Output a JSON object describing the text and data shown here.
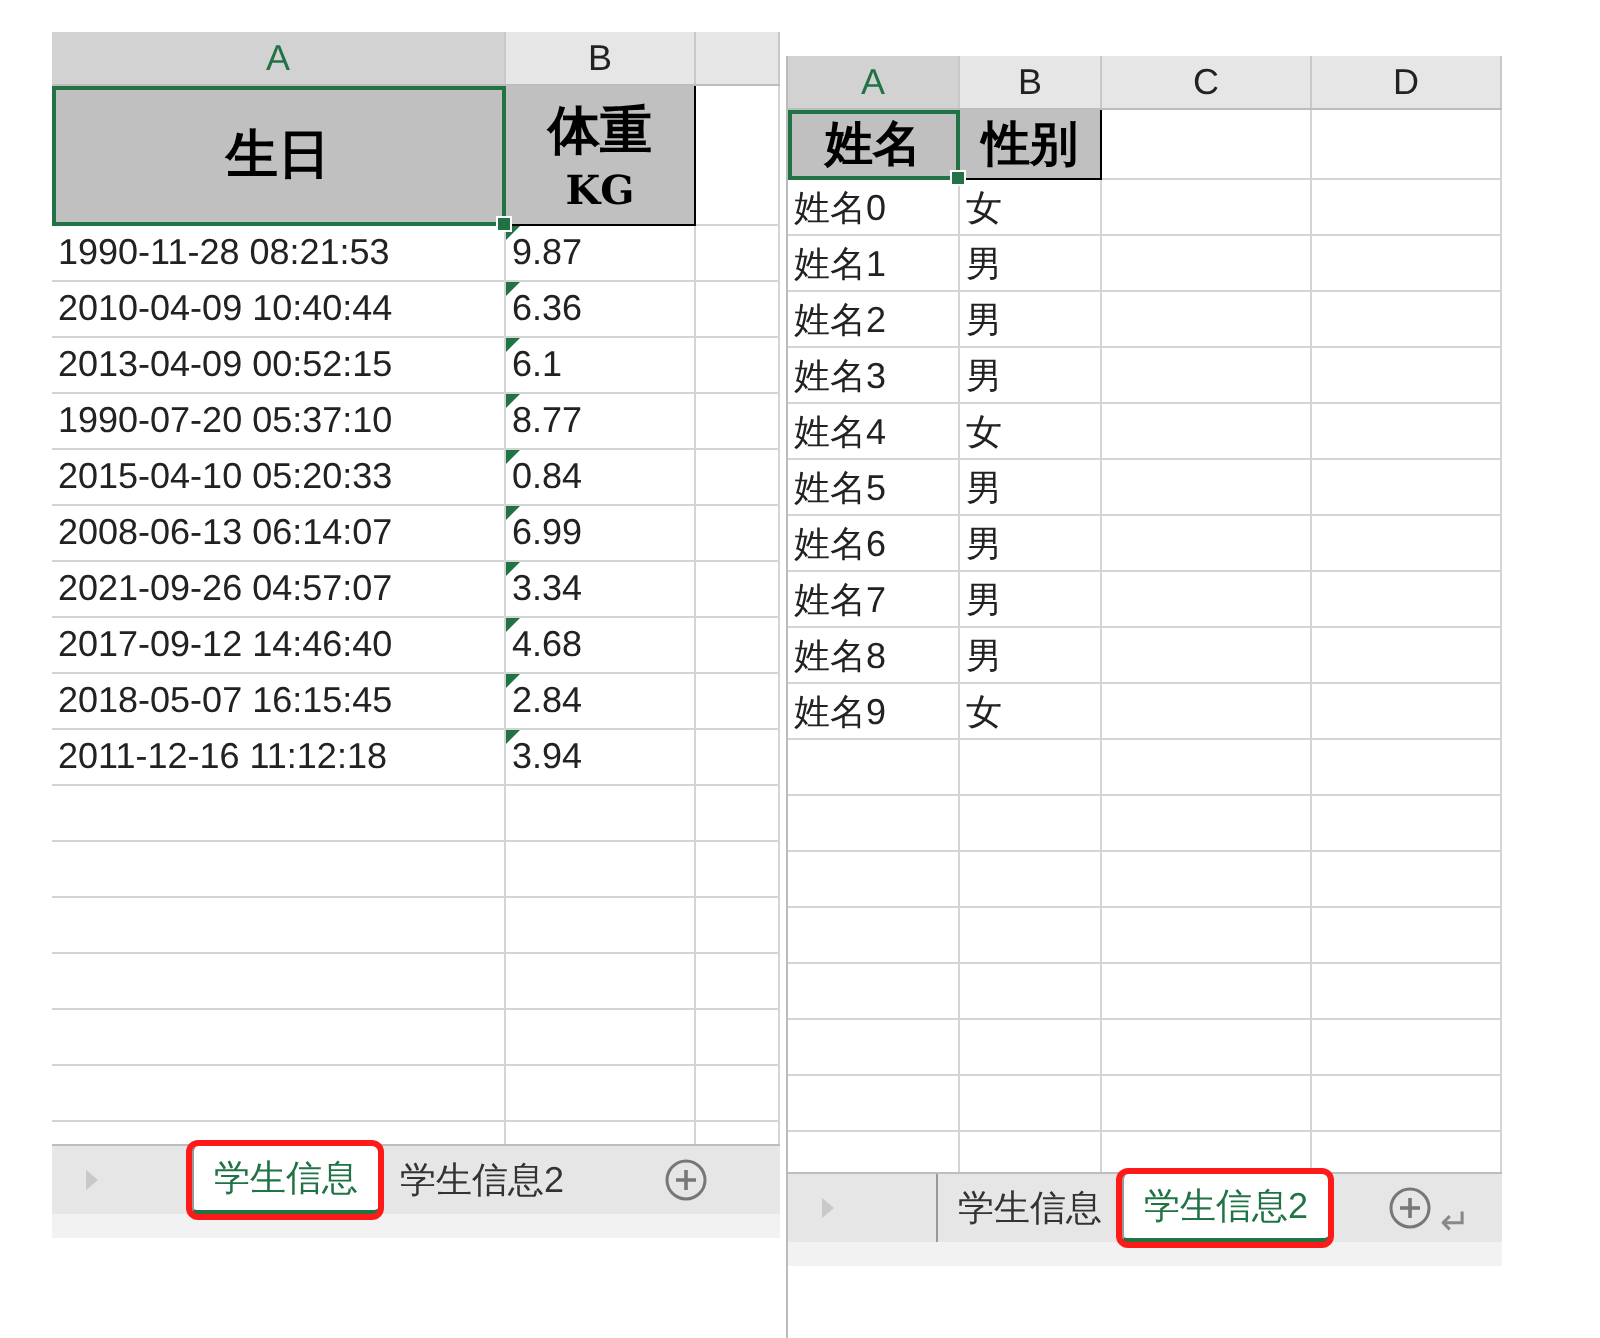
{
  "sheets": [
    {
      "columns": [
        {
          "label": "A",
          "selected": true
        },
        {
          "label": "B",
          "selected": false
        }
      ],
      "header": [
        {
          "lines": [
            "生日"
          ],
          "selected": true
        },
        {
          "lines": [
            "体重",
            "KG"
          ],
          "selected": false
        }
      ],
      "rows": [
        {
          "cells": [
            "1990-11-28 08:21:53",
            "9.87"
          ],
          "number_as_text": true
        },
        {
          "cells": [
            "2010-04-09 10:40:44",
            "6.36"
          ],
          "number_as_text": true
        },
        {
          "cells": [
            "2013-04-09 00:52:15",
            "6.1"
          ],
          "number_as_text": true
        },
        {
          "cells": [
            "1990-07-20 05:37:10",
            "8.77"
          ],
          "number_as_text": true
        },
        {
          "cells": [
            "2015-04-10 05:20:33",
            "0.84"
          ],
          "number_as_text": true
        },
        {
          "cells": [
            "2008-06-13 06:14:07",
            "6.99"
          ],
          "number_as_text": true
        },
        {
          "cells": [
            "2021-09-26 04:57:07",
            "3.34"
          ],
          "number_as_text": true
        },
        {
          "cells": [
            "2017-09-12 14:46:40",
            "4.68"
          ],
          "number_as_text": true
        },
        {
          "cells": [
            "2018-05-07 16:15:45",
            "2.84"
          ],
          "number_as_text": true
        },
        {
          "cells": [
            "2011-12-16 11:12:18",
            "3.94"
          ],
          "number_as_text": true
        }
      ],
      "tabs": [
        {
          "label": "学生信息",
          "selected": true,
          "highlighted": true
        },
        {
          "label": "学生信息2",
          "selected": false,
          "highlighted": false
        }
      ]
    },
    {
      "columns": [
        {
          "label": "A",
          "selected": true
        },
        {
          "label": "B",
          "selected": false
        },
        {
          "label": "C",
          "selected": false
        },
        {
          "label": "D",
          "selected": false
        }
      ],
      "header": [
        {
          "lines": [
            "姓名"
          ],
          "selected": true
        },
        {
          "lines": [
            "性别"
          ],
          "selected": false
        }
      ],
      "rows": [
        {
          "cells": [
            "姓名0",
            "女"
          ]
        },
        {
          "cells": [
            "姓名1",
            "男"
          ]
        },
        {
          "cells": [
            "姓名2",
            "男"
          ]
        },
        {
          "cells": [
            "姓名3",
            "男"
          ]
        },
        {
          "cells": [
            "姓名4",
            "女"
          ]
        },
        {
          "cells": [
            "姓名5",
            "男"
          ]
        },
        {
          "cells": [
            "姓名6",
            "男"
          ]
        },
        {
          "cells": [
            "姓名7",
            "男"
          ]
        },
        {
          "cells": [
            "姓名8",
            "男"
          ]
        },
        {
          "cells": [
            "姓名9",
            "女"
          ]
        }
      ],
      "tabs": [
        {
          "label": "学生信息",
          "selected": false,
          "highlighted": false
        },
        {
          "label": "学生信息2",
          "selected": true,
          "highlighted": true
        }
      ]
    }
  ],
  "return_mark": "↵"
}
